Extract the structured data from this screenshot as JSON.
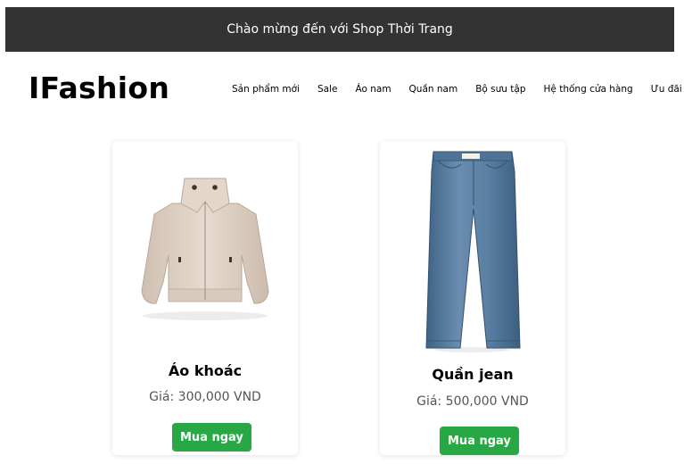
{
  "banner": {
    "text": "Chào mừng đến với Shop Thời Trang"
  },
  "header": {
    "logo": "IFashion",
    "nav": [
      "Sản phẩm mới",
      "Sale",
      "Áo nam",
      "Quần nam",
      "Bộ sưu tập",
      "Hệ thống cửa hàng",
      "Ưu đãi"
    ]
  },
  "products": [
    {
      "name": "Áo khoác",
      "price_label": "Giá:",
      "price": "300,000 VND",
      "button": "Mua ngay",
      "image": "beige-jacket",
      "image_color": "#e2d5c8"
    },
    {
      "name": "Quần jean",
      "price_label": "Giá:",
      "price": "500,000 VND",
      "button": "Mua ngay",
      "image": "blue-jeans",
      "image_color": "#557a9c"
    }
  ],
  "colors": {
    "banner_bg": "#333333",
    "button_bg": "#28a745"
  }
}
